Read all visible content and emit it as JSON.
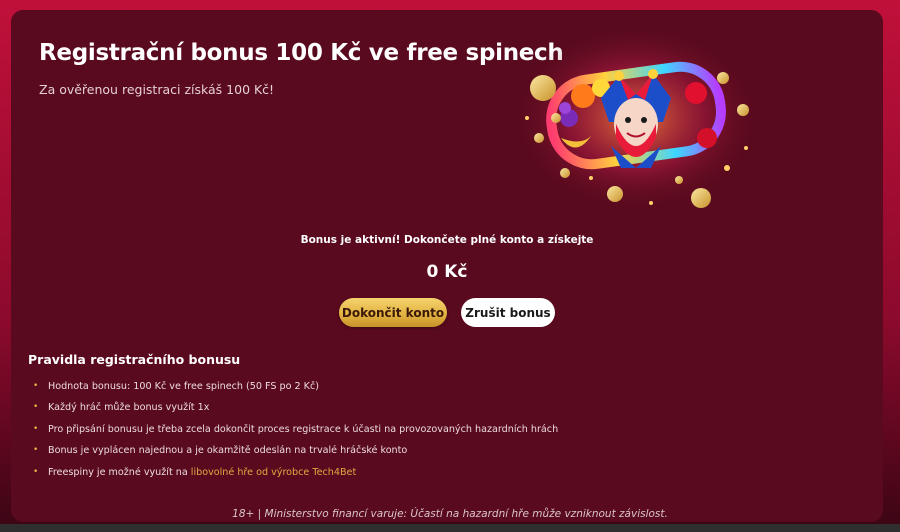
{
  "hero": {
    "title": "Registrační bonus 100 Kč ve free spinech",
    "subtitle": "Za ověřenou registraci získáš 100 Kč!"
  },
  "status": {
    "message": "Bonus je aktivní! Dokončete plné konto a získejte",
    "amount": "0 Kč"
  },
  "actions": {
    "complete_label": "Dokončit konto",
    "cancel_label": "Zrušit bonus"
  },
  "rules": {
    "title": "Pravidla registračního bonusu",
    "items": [
      "Hodnota bonusu: 100 Kč ve free spinech (50 FS po 2 Kč)",
      "Každý hráč může bonus využít 1x",
      "Pro připsání bonusu je třeba zcela dokončit proces registrace k účasti na provozovaných hazardních hrách",
      "Bonus je vyplácen najednou a je okamžitě odeslán na trvalé hráčské konto"
    ],
    "last_item_prefix": "Freespiny je možné využít na ",
    "last_item_link": "libovolné hře od výrobce Tech4Bet"
  },
  "footer": {
    "warning": "18+ | Ministerstvo financí varuje: Účastí na hazardní hře může vzniknout závislost."
  },
  "icons": {
    "hero_art": "joker-slot-illustration"
  },
  "colors": {
    "page_bg": "#b00f35",
    "panel_bg": "#5a0a1e",
    "gold_accent": "#e3b443",
    "link": "#e3a843"
  }
}
